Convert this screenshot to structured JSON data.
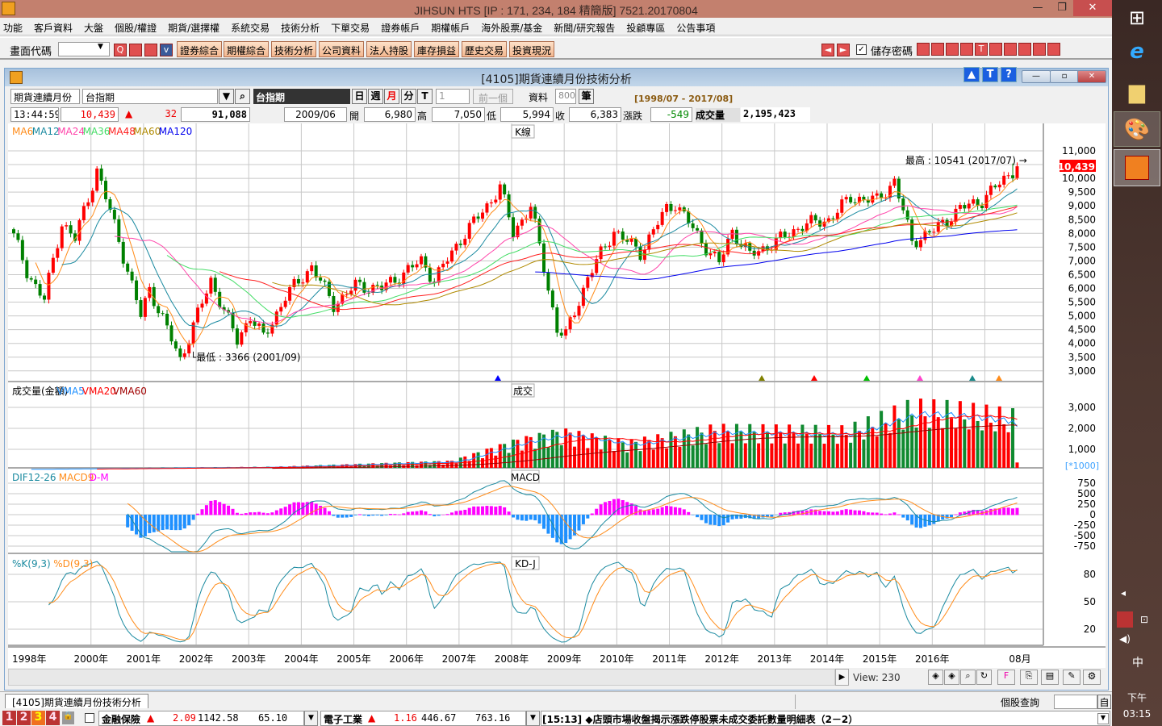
{
  "window": {
    "title": "JIHSUN HTS     [IP : 171, 234, 184 精簡版] 7521.20170804",
    "minimize": "—",
    "restore": "❐",
    "close": "✕"
  },
  "menu": [
    "功能",
    "客戶資料",
    "大盤",
    "個股/權證",
    "期貨/選擇權",
    "系統交易",
    "技術分析",
    "下單交易",
    "證券帳戶",
    "期權帳戶",
    "海外股票/基金",
    "新聞/研究報告",
    "投顧專區",
    "公告事項"
  ],
  "toolbar": {
    "code_label": "畫面代碼",
    "code_value": "",
    "buttons": [
      "證券綜合",
      "期權綜合",
      "技術分析",
      "公司資料",
      "法人持股",
      "庫存損益",
      "歷史交易",
      "投資現況"
    ],
    "save_password": "儲存密碼",
    "save_password_checked": true
  },
  "inner": {
    "title": "[4105]期貨連續月份技術分析",
    "help": "?",
    "t": "T",
    "up": "▲"
  },
  "controls": {
    "type_select": "期貨連續月份",
    "symbol_input": "台指期",
    "symbol_name": "台指期",
    "periods": [
      "日",
      "週",
      "月",
      "分",
      "T"
    ],
    "active_period": "月",
    "multiplier": "1",
    "prev": "前一個",
    "data_label": "資料",
    "data_count": "800",
    "data_unit": "筆",
    "range": "[1998/07 - 2017/08]"
  },
  "quote": {
    "time": "13:44:59",
    "price": "10,439",
    "arrow": "▲",
    "change": "32",
    "volume": "91,088",
    "date": "2009/06",
    "open_label": "開",
    "open": "6,980",
    "high_label": "高",
    "high": "7,050",
    "low_label": "低",
    "low": "5,994",
    "close_label": "收",
    "close": "6,383",
    "chg_label": "漲跌",
    "chg": "-549",
    "vol_label": "成交量",
    "vol": "2,195,423"
  },
  "panels": {
    "price": {
      "tag": "K線",
      "legend": [
        "MA6",
        "MA12",
        "MA24",
        "MA36",
        "MA48",
        "MA60",
        "MA120"
      ],
      "legend_colors": [
        "#ff8c1a",
        "#1a8aa0",
        "#ff44aa",
        "#44dd66",
        "#ff2020",
        "#b08a00",
        "#0000ee"
      ],
      "high_note": "最高 : 10541 (2017/07)",
      "low_note": "最低 : 3366 (2001/09)",
      "last": "10,439",
      "ticks": [
        "11,000",
        "10,500",
        "10,000",
        "9,500",
        "9,000",
        "8,500",
        "8,000",
        "7,500",
        "7,000",
        "6,500",
        "6,000",
        "5,500",
        "5,000",
        "4,500",
        "4,000",
        "3,500",
        "3,000"
      ]
    },
    "volume": {
      "tag": "成交",
      "legend": [
        "成交量(金額)",
        "VMA5",
        "VMA20",
        "VMA60"
      ],
      "legend_colors": [
        "#000000",
        "#1e90ff",
        "#ff0000",
        "#a00000"
      ],
      "ticks": [
        "3,000",
        "2,000",
        "1,000"
      ],
      "unit": "[*1000]"
    },
    "macd": {
      "tag": "MACD",
      "legend": [
        "DIF12-26",
        "MACD9",
        "D-M"
      ],
      "legend_colors": [
        "#1a8aa0",
        "#ff8c1a",
        "#ff00ff"
      ],
      "ticks": [
        "750",
        "500",
        "250",
        "0",
        "-250",
        "-500",
        "-750"
      ]
    },
    "kd": {
      "tag": "KD-J",
      "legend": [
        "%K(9,3)",
        "%D(9,3)"
      ],
      "legend_colors": [
        "#1a8aa0",
        "#ff8c1a"
      ],
      "ticks": [
        "80",
        "50",
        "20"
      ]
    }
  },
  "xaxis": [
    "1998年",
    "2000年",
    "2001年",
    "2002年",
    "2003年",
    "2004年",
    "2005年",
    "2006年",
    "2007年",
    "2008年",
    "2009年",
    "2010年",
    "2011年",
    "2012年",
    "2013年",
    "2014年",
    "2015年",
    "2016年",
    "08月"
  ],
  "view": "View: 230",
  "chart_data": {
    "type": "candlestick",
    "start": "1998/07",
    "months": 230,
    "close_keypoints": [
      [
        0,
        7900
      ],
      [
        3,
        6600
      ],
      [
        7,
        5600
      ],
      [
        11,
        8400
      ],
      [
        14,
        7800
      ],
      [
        19,
        10300
      ],
      [
        23,
        8300
      ],
      [
        29,
        5000
      ],
      [
        31,
        6000
      ],
      [
        38,
        3400
      ],
      [
        45,
        6300
      ],
      [
        51,
        4100
      ],
      [
        54,
        5000
      ],
      [
        57,
        4200
      ],
      [
        62,
        5700
      ],
      [
        68,
        6800
      ],
      [
        73,
        5400
      ],
      [
        78,
        6100
      ],
      [
        84,
        6000
      ],
      [
        93,
        7000
      ],
      [
        96,
        6300
      ],
      [
        102,
        7800
      ],
      [
        108,
        9000
      ],
      [
        111,
        9700
      ],
      [
        114,
        8000
      ],
      [
        118,
        9000
      ],
      [
        124,
        4500
      ],
      [
        126,
        4300
      ],
      [
        131,
        6400
      ],
      [
        137,
        8100
      ],
      [
        143,
        7300
      ],
      [
        149,
        8900
      ],
      [
        151,
        9100
      ],
      [
        157,
        7700
      ],
      [
        161,
        6900
      ],
      [
        164,
        8100
      ],
      [
        168,
        7200
      ],
      [
        174,
        7700
      ],
      [
        180,
        8300
      ],
      [
        186,
        8500
      ],
      [
        191,
        9300
      ],
      [
        197,
        9200
      ],
      [
        201,
        9900
      ],
      [
        205,
        7700
      ],
      [
        210,
        8100
      ],
      [
        216,
        8900
      ],
      [
        221,
        9200
      ],
      [
        229,
        10439
      ]
    ],
    "volume_keypoints": [
      [
        0,
        40
      ],
      [
        60,
        150
      ],
      [
        100,
        400
      ],
      [
        115,
        1300
      ],
      [
        125,
        1700
      ],
      [
        140,
        1200
      ],
      [
        160,
        1800
      ],
      [
        190,
        1700
      ],
      [
        205,
        2700
      ],
      [
        215,
        2600
      ],
      [
        228,
        2300
      ],
      [
        229,
        400
      ]
    ],
    "ylim_price": [
      3000,
      11000
    ],
    "high": 10541,
    "low": 3366,
    "last": 10439
  },
  "status": {
    "tab": "[4105]期貨連續月份技術分析",
    "query_label": "個股查詢",
    "query_btn": "自",
    "nums": [
      "1",
      "2",
      "3",
      "4"
    ],
    "ticker1": {
      "name": "金融保險",
      "arrow": "▲",
      "chg": "2.09",
      "idx": "1142.58",
      "amt": "65.10"
    },
    "ticker2": {
      "name": "電子工業",
      "arrow": "▲",
      "chg": "1.16",
      "idx": "446.67",
      "amt": "763.16"
    },
    "news": "[15:13] ◆店頭市場收盤揭示漲跌停股票未成交委託數量明細表（2－2）"
  },
  "taskbar": {
    "ime": "中",
    "clock": "下午 03:15"
  }
}
